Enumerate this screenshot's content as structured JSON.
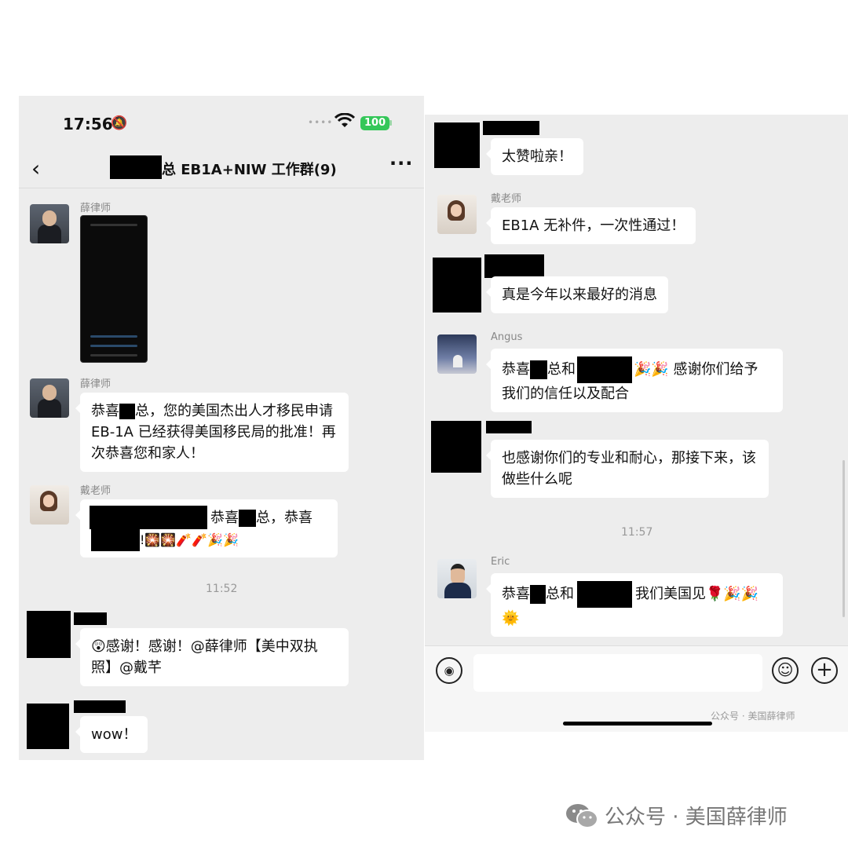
{
  "watermark": {
    "text": "公众号 · 美国薛律师",
    "icon": "wechat-icon"
  },
  "left_phone": {
    "status": {
      "time": "17:56",
      "battery": "100",
      "signal_dots": "••••"
    },
    "nav": {
      "back_icon": "‹",
      "title": "总 EB1A+NIW 工作群(9)",
      "more_icon": "···"
    },
    "messages": {
      "m1": {
        "sender": "薛律师"
      },
      "m2": {
        "sender": "薛律师",
        "p1": "恭喜",
        "p2": "总，您的美国杰出人才移民申请 EB-1A 已经获得美国移民局的批准！再次恭喜您和家人！"
      },
      "m3": {
        "sender": "戴老师",
        "p1": "恭喜",
        "p2": "总，恭喜",
        "p3": "!🎇🎇🧨🧨🎉🎉"
      },
      "time1": "11:52",
      "m4": {
        "text": "😲感谢！感谢！@薛律师【美中双执照】@戴芊"
      },
      "m5": {
        "text": "wow！"
      }
    }
  },
  "right_phone": {
    "messages": {
      "r1": {
        "text": "太赞啦亲！"
      },
      "r2": {
        "sender": "戴老师",
        "text": "EB1A 无补件，一次性通过！"
      },
      "r3": {
        "text": "真是今年以来最好的消息"
      },
      "r4": {
        "sender": "Angus",
        "p1": "恭喜",
        "p2": "总和",
        "p3": "🎉🎉 感谢你们给予我们的信任以及配合"
      },
      "r5": {
        "text": "也感谢你们的专业和耐心，那接下来，该做些什么呢"
      },
      "time2": "11:57",
      "r6": {
        "sender": "Eric",
        "p1": "恭喜",
        "p2": "总和",
        "p3": "我们美国见🌹🎉🎉🌞"
      }
    },
    "input": {
      "voice_icon": "◉",
      "emoji_icon": "☺",
      "plus_icon": "+"
    },
    "watermark_small": "公众号 · 美国薛律师"
  }
}
